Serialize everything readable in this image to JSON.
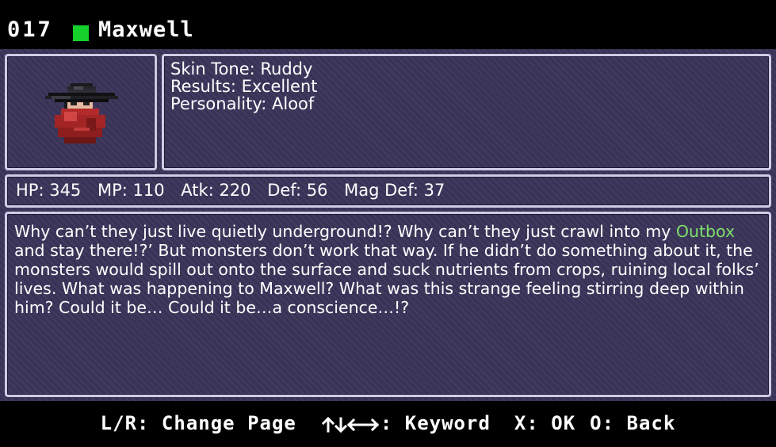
{
  "header": {
    "id": "017",
    "name": "Maxwell",
    "marker_color": "#15d02b",
    "marker_icon": "green-square-icon"
  },
  "portrait": {
    "icon": "black-hat-red-cloak-villain-sprite"
  },
  "info": {
    "skin_tone": "Skin Tone: Ruddy",
    "results": "Results: Excellent",
    "personality": "Personality: Aloof"
  },
  "stats": {
    "hp": "HP: 345",
    "mp": "MP: 110",
    "atk": "Atk: 220",
    "def": "Def: 56",
    "mag_def": "Mag Def: 37"
  },
  "description": {
    "before_keyword": "Why can’t they just live quietly underground!? Why can’t they just crawl into my ",
    "keyword": "Outbox",
    "after_keyword": " and stay there!?’ But monsters don’t work that way. If he didn’t do something about it, the monsters would spill out onto the surface and suck nutrients from crops, ruining local folks’ lives. What was happening to Maxwell? What was this strange feeling stirring deep within him? Could it be… Could it be…a conscience…!?",
    "keyword_color": "#7ee06a"
  },
  "footer": {
    "change_page": "L/R: Change Page",
    "keyword_hint": ": Keyword",
    "keyword_icon": "directional-arrows-icon",
    "ok": "X: OK",
    "back": "O: Back"
  },
  "colors": {
    "background": "#3a3358",
    "panel_border": "#cfcbe6",
    "text": "#ffffff"
  }
}
